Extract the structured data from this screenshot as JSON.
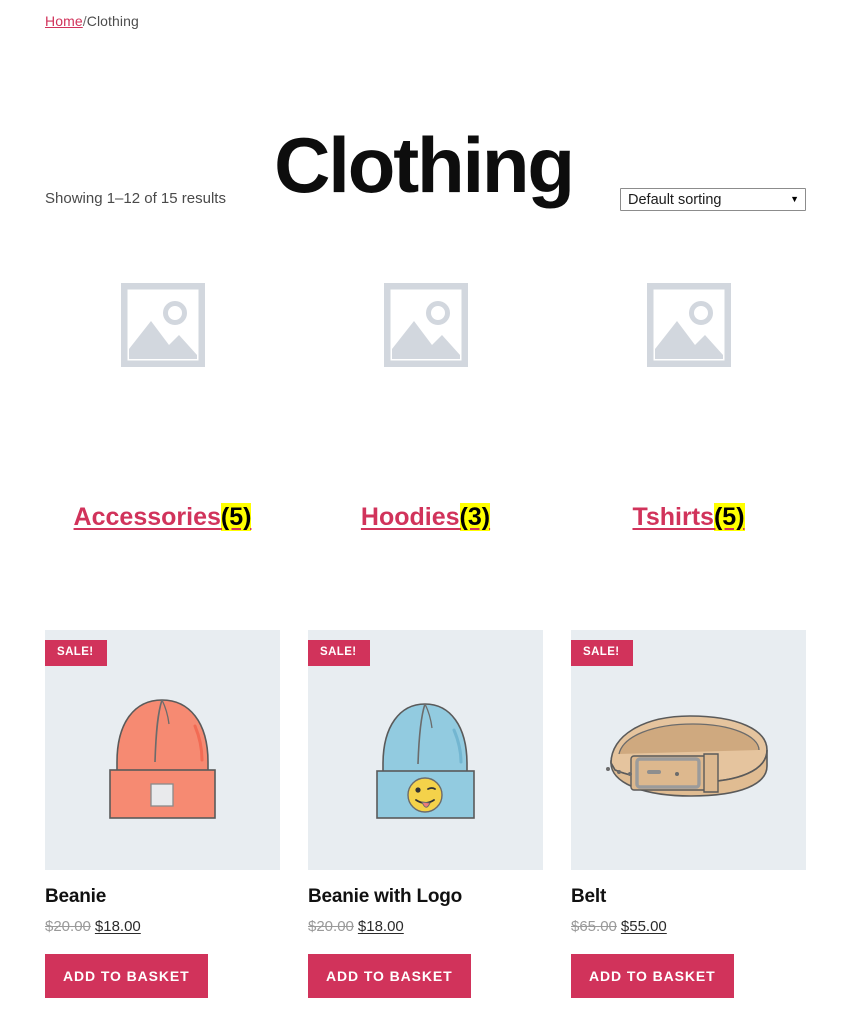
{
  "breadcrumb": {
    "home_label": "Home",
    "separator": "/",
    "current_label": "Clothing"
  },
  "page_title": "Clothing",
  "result_count": "Showing 1–12 of 15 results",
  "sorting": {
    "selected": "Default sorting",
    "caret": "▼",
    "options": [
      "Default sorting"
    ]
  },
  "categories": [
    {
      "name": "Accessories",
      "count": "(5)",
      "thumb_icon": "image-placeholder-icon"
    },
    {
      "name": "Hoodies",
      "count": "(3)",
      "thumb_icon": "image-placeholder-icon"
    },
    {
      "name": "Tshirts",
      "count": "(5)",
      "thumb_icon": "image-placeholder-icon"
    }
  ],
  "products": [
    {
      "badge": "SALE!",
      "title": "Beanie",
      "old_price": "$20.00",
      "new_price": "$18.00",
      "button_label": "ADD TO BASKET",
      "art": "beanie-coral-illustration"
    },
    {
      "badge": "SALE!",
      "title": "Beanie with Logo",
      "old_price": "$20.00",
      "new_price": "$18.00",
      "button_label": "ADD TO BASKET",
      "art": "beanie-blue-emoji-illustration"
    },
    {
      "badge": "SALE!",
      "title": "Belt",
      "old_price": "$65.00",
      "new_price": "$55.00",
      "button_label": "ADD TO BASKET",
      "art": "belt-tan-illustration"
    }
  ],
  "colors": {
    "accent": "#d1335b",
    "highlight": "#ffff00",
    "product_bg": "#e8edf1",
    "placeholder_gray": "#cfd4db"
  }
}
